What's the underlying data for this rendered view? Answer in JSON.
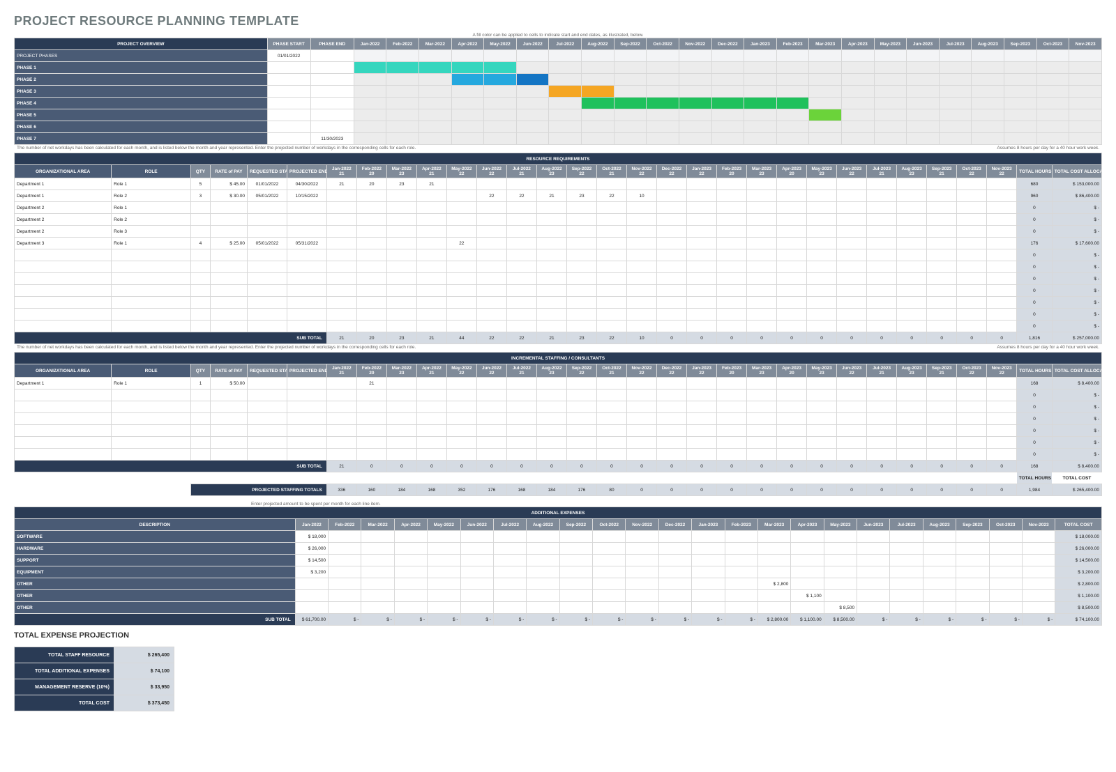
{
  "title": "PROJECT RESOURCE PLANNING TEMPLATE",
  "notes": {
    "gantt_hint": "A fill color can be applied to cells to indicate start and end dates, as illustrated, below.",
    "hours_hint": "The number of net workdays has been calculated for each month, and is listed below the month and year represented. Enter the projected number of workdays in the corresponding cells for each role.",
    "hours_assume": "Assumes 8 hours per day for a 40 hour work week.",
    "exp_hint": "Enter projected amount to be spent per month for each line item."
  },
  "months": [
    "Jan-2022",
    "Feb-2022",
    "Mar-2022",
    "Apr-2022",
    "May-2022",
    "Jun-2022",
    "Jul-2022",
    "Aug-2022",
    "Sep-2022",
    "Oct-2022",
    "Nov-2022",
    "Dec-2022",
    "Jan-2023",
    "Feb-2023",
    "Mar-2023",
    "Apr-2023",
    "May-2023",
    "Jun-2023",
    "Jul-2023",
    "Aug-2023",
    "Sep-2023",
    "Oct-2023",
    "Nov-2023"
  ],
  "workdays": [
    "21",
    "20",
    "23",
    "21",
    "22",
    "22",
    "21",
    "23",
    "22",
    "21",
    "22",
    "22",
    "22",
    "20",
    "23",
    "20",
    "23",
    "22",
    "21",
    "23",
    "21",
    "22",
    "22"
  ],
  "po": {
    "header": "PROJECT OVERVIEW",
    "cols": [
      "PHASE START",
      "PHASE END"
    ],
    "rows": [
      {
        "label": "PROJECT PHASES",
        "start": "01/01/2022",
        "end": "",
        "fill": []
      },
      {
        "label": "PHASE 1",
        "start": "",
        "end": "",
        "fill": [
          {
            "from": 0,
            "to": 4,
            "cls": "g1"
          }
        ]
      },
      {
        "label": "PHASE 2",
        "start": "",
        "end": "",
        "fill": [
          {
            "from": 3,
            "to": 4,
            "cls": "g2"
          },
          {
            "from": 5,
            "to": 5,
            "cls": "g2b"
          }
        ]
      },
      {
        "label": "PHASE 3",
        "start": "",
        "end": "",
        "fill": [
          {
            "from": 6,
            "to": 7,
            "cls": "g3"
          }
        ]
      },
      {
        "label": "PHASE 4",
        "start": "",
        "end": "",
        "fill": [
          {
            "from": 7,
            "to": 13,
            "cls": "g4"
          }
        ]
      },
      {
        "label": "PHASE 5",
        "start": "",
        "end": "",
        "fill": [
          {
            "from": 14,
            "to": 14,
            "cls": "g5"
          }
        ]
      },
      {
        "label": "PHASE 6",
        "start": "",
        "end": "",
        "fill": []
      },
      {
        "label": "PHASE 7",
        "start": "",
        "end": "11/30/2023",
        "fill": []
      }
    ]
  },
  "resource_header": "RESOURCE REQUIREMENTS",
  "resource_cols": {
    "area": "ORGANIZATIONAL AREA",
    "role": "ROLE",
    "qty": "QTY",
    "rate": "RATE of PAY",
    "start": "REQUESTED START DATE",
    "end": "PROJECTED END DATE",
    "thours": "TOTAL HOURS",
    "tcost": "TOTAL COST ALLOCATED"
  },
  "resource_rows": [
    {
      "area": "Department 1",
      "role": "Role 1",
      "qty": "5",
      "rate": "$   45.00",
      "start": "01/01/2022",
      "end": "04/30/2022",
      "wd": [
        "21",
        "20",
        "23",
        "21",
        "",
        "",
        "",
        "",
        "",
        "",
        "",
        "",
        "",
        "",
        "",
        "",
        "",
        "",
        "",
        "",
        "",
        "",
        ""
      ],
      "th": "680",
      "tc": "$   153,000.00"
    },
    {
      "area": "Department 1",
      "role": "Role 2",
      "qty": "3",
      "rate": "$   30.00",
      "start": "05/01/2022",
      "end": "10/15/2022",
      "wd": [
        "",
        "",
        "",
        "",
        "",
        "22",
        "22",
        "21",
        "23",
        "22",
        "10",
        "",
        "",
        "",
        "",
        "",
        "",
        "",
        "",
        "",
        "",
        "",
        ""
      ],
      "th": "960",
      "tc": "$    86,400.00"
    },
    {
      "area": "Department 2",
      "role": "Role 1",
      "qty": "",
      "rate": "",
      "start": "",
      "end": "",
      "wd": [
        "",
        "",
        "",
        "",
        "",
        "",
        "",
        "",
        "",
        "",
        "",
        "",
        "",
        "",
        "",
        "",
        "",
        "",
        "",
        "",
        "",
        "",
        ""
      ],
      "th": "0",
      "tc": "$          -"
    },
    {
      "area": "Department 2",
      "role": "Role 2",
      "qty": "",
      "rate": "",
      "start": "",
      "end": "",
      "wd": [
        "",
        "",
        "",
        "",
        "",
        "",
        "",
        "",
        "",
        "",
        "",
        "",
        "",
        "",
        "",
        "",
        "",
        "",
        "",
        "",
        "",
        "",
        ""
      ],
      "th": "0",
      "tc": "$          -"
    },
    {
      "area": "Department 2",
      "role": "Role 3",
      "qty": "",
      "rate": "",
      "start": "",
      "end": "",
      "wd": [
        "",
        "",
        "",
        "",
        "",
        "",
        "",
        "",
        "",
        "",
        "",
        "",
        "",
        "",
        "",
        "",
        "",
        "",
        "",
        "",
        "",
        "",
        ""
      ],
      "th": "0",
      "tc": "$          -"
    },
    {
      "area": "Department 3",
      "role": "Role 1",
      "qty": "4",
      "rate": "$   25.00",
      "start": "05/01/2022",
      "end": "05/31/2022",
      "wd": [
        "",
        "",
        "",
        "",
        "22",
        "",
        "",
        "",
        "",
        "",
        "",
        "",
        "",
        "",
        "",
        "",
        "",
        "",
        "",
        "",
        "",
        "",
        ""
      ],
      "th": "176",
      "tc": "$    17,600.00"
    },
    {
      "area": "",
      "role": "",
      "qty": "",
      "rate": "",
      "start": "",
      "end": "",
      "wd": [
        "",
        "",
        "",
        "",
        "",
        "",
        "",
        "",
        "",
        "",
        "",
        "",
        "",
        "",
        "",
        "",
        "",
        "",
        "",
        "",
        "",
        "",
        ""
      ],
      "th": "0",
      "tc": "$          -"
    },
    {
      "area": "",
      "role": "",
      "qty": "",
      "rate": "",
      "start": "",
      "end": "",
      "wd": [
        "",
        "",
        "",
        "",
        "",
        "",
        "",
        "",
        "",
        "",
        "",
        "",
        "",
        "",
        "",
        "",
        "",
        "",
        "",
        "",
        "",
        "",
        ""
      ],
      "th": "0",
      "tc": "$          -"
    },
    {
      "area": "",
      "role": "",
      "qty": "",
      "rate": "",
      "start": "",
      "end": "",
      "wd": [
        "",
        "",
        "",
        "",
        "",
        "",
        "",
        "",
        "",
        "",
        "",
        "",
        "",
        "",
        "",
        "",
        "",
        "",
        "",
        "",
        "",
        "",
        ""
      ],
      "th": "0",
      "tc": "$          -"
    },
    {
      "area": "",
      "role": "",
      "qty": "",
      "rate": "",
      "start": "",
      "end": "",
      "wd": [
        "",
        "",
        "",
        "",
        "",
        "",
        "",
        "",
        "",
        "",
        "",
        "",
        "",
        "",
        "",
        "",
        "",
        "",
        "",
        "",
        "",
        "",
        ""
      ],
      "th": "0",
      "tc": "$          -"
    },
    {
      "area": "",
      "role": "",
      "qty": "",
      "rate": "",
      "start": "",
      "end": "",
      "wd": [
        "",
        "",
        "",
        "",
        "",
        "",
        "",
        "",
        "",
        "",
        "",
        "",
        "",
        "",
        "",
        "",
        "",
        "",
        "",
        "",
        "",
        "",
        ""
      ],
      "th": "0",
      "tc": "$          -"
    },
    {
      "area": "",
      "role": "",
      "qty": "",
      "rate": "",
      "start": "",
      "end": "",
      "wd": [
        "",
        "",
        "",
        "",
        "",
        "",
        "",
        "",
        "",
        "",
        "",
        "",
        "",
        "",
        "",
        "",
        "",
        "",
        "",
        "",
        "",
        "",
        ""
      ],
      "th": "0",
      "tc": "$          -"
    },
    {
      "area": "",
      "role": "",
      "qty": "",
      "rate": "",
      "start": "",
      "end": "",
      "wd": [
        "",
        "",
        "",
        "",
        "",
        "",
        "",
        "",
        "",
        "",
        "",
        "",
        "",
        "",
        "",
        "",
        "",
        "",
        "",
        "",
        "",
        "",
        ""
      ],
      "th": "0",
      "tc": "$          -"
    }
  ],
  "resource_subtotal": {
    "label": "SUB TOTAL",
    "wd": [
      "21",
      "20",
      "23",
      "21",
      "44",
      "22",
      "22",
      "21",
      "23",
      "22",
      "10",
      "0",
      "0",
      "0",
      "0",
      "0",
      "0",
      "0",
      "0",
      "0",
      "0",
      "0",
      "0"
    ],
    "th": "1,816",
    "tc": "$   257,000.00"
  },
  "inc_header": "INCREMENTAL STAFFING / CONSULTANTS",
  "inc_rows": [
    {
      "area": "Department 1",
      "role": "Role 1",
      "qty": "1",
      "rate": "$   50.00",
      "start": "",
      "end": "",
      "wd": [
        "",
        "21",
        "",
        "",
        "",
        "",
        "",
        "",
        "",
        "",
        "",
        "",
        "",
        "",
        "",
        "",
        "",
        "",
        "",
        "",
        "",
        "",
        ""
      ],
      "th": "168",
      "tc": "$     8,400.00"
    },
    {
      "area": "",
      "role": "",
      "qty": "",
      "rate": "",
      "start": "",
      "end": "",
      "wd": [
        "",
        "",
        "",
        "",
        "",
        "",
        "",
        "",
        "",
        "",
        "",
        "",
        "",
        "",
        "",
        "",
        "",
        "",
        "",
        "",
        "",
        "",
        ""
      ],
      "th": "0",
      "tc": "$          -"
    },
    {
      "area": "",
      "role": "",
      "qty": "",
      "rate": "",
      "start": "",
      "end": "",
      "wd": [
        "",
        "",
        "",
        "",
        "",
        "",
        "",
        "",
        "",
        "",
        "",
        "",
        "",
        "",
        "",
        "",
        "",
        "",
        "",
        "",
        "",
        "",
        ""
      ],
      "th": "0",
      "tc": "$          -"
    },
    {
      "area": "",
      "role": "",
      "qty": "",
      "rate": "",
      "start": "",
      "end": "",
      "wd": [
        "",
        "",
        "",
        "",
        "",
        "",
        "",
        "",
        "",
        "",
        "",
        "",
        "",
        "",
        "",
        "",
        "",
        "",
        "",
        "",
        "",
        "",
        ""
      ],
      "th": "0",
      "tc": "$          -"
    },
    {
      "area": "",
      "role": "",
      "qty": "",
      "rate": "",
      "start": "",
      "end": "",
      "wd": [
        "",
        "",
        "",
        "",
        "",
        "",
        "",
        "",
        "",
        "",
        "",
        "",
        "",
        "",
        "",
        "",
        "",
        "",
        "",
        "",
        "",
        "",
        ""
      ],
      "th": "0",
      "tc": "$          -"
    },
    {
      "area": "",
      "role": "",
      "qty": "",
      "rate": "",
      "start": "",
      "end": "",
      "wd": [
        "",
        "",
        "",
        "",
        "",
        "",
        "",
        "",
        "",
        "",
        "",
        "",
        "",
        "",
        "",
        "",
        "",
        "",
        "",
        "",
        "",
        "",
        ""
      ],
      "th": "0",
      "tc": "$          -"
    },
    {
      "area": "",
      "role": "",
      "qty": "",
      "rate": "",
      "start": "",
      "end": "",
      "wd": [
        "",
        "",
        "",
        "",
        "",
        "",
        "",
        "",
        "",
        "",
        "",
        "",
        "",
        "",
        "",
        "",
        "",
        "",
        "",
        "",
        "",
        "",
        ""
      ],
      "th": "0",
      "tc": "$          -"
    }
  ],
  "inc_subtotal": {
    "label": "SUB TOTAL",
    "wd": [
      "21",
      "0",
      "0",
      "0",
      "0",
      "0",
      "0",
      "0",
      "0",
      "0",
      "0",
      "0",
      "0",
      "0",
      "0",
      "0",
      "0",
      "0",
      "0",
      "0",
      "0",
      "0",
      "0"
    ],
    "th": "168",
    "tc": "$     8,400.00"
  },
  "inc_totals_label": {
    "th": "TOTAL HOURS",
    "tc": "TOTAL COST"
  },
  "proj_total": {
    "label": "PROJECTED STAFFING TOTALS",
    "wd": [
      "336",
      "160",
      "184",
      "168",
      "352",
      "176",
      "168",
      "184",
      "176",
      "80",
      "0",
      "0",
      "0",
      "0",
      "0",
      "0",
      "0",
      "0",
      "0",
      "0",
      "0",
      "0",
      "0"
    ],
    "th": "1,984",
    "tc": "$   265,400.00"
  },
  "exp_header": "ADDITIONAL EXPENSES",
  "exp_cols": {
    "desc": "DESCRIPTION",
    "tot": "TOTAL COST"
  },
  "exp_rows": [
    {
      "desc": "SOFTWARE",
      "m": [
        "$   18,000",
        "",
        "",
        "",
        "",
        "",
        "",
        "",
        "",
        "",
        "",
        "",
        "",
        "",
        "",
        "",
        "",
        "",
        "",
        "",
        "",
        "",
        ""
      ],
      "tot": "$   18,000.00"
    },
    {
      "desc": "HARDWARE",
      "m": [
        "$   26,000",
        "",
        "",
        "",
        "",
        "",
        "",
        "",
        "",
        "",
        "",
        "",
        "",
        "",
        "",
        "",
        "",
        "",
        "",
        "",
        "",
        "",
        ""
      ],
      "tot": "$   26,000.00"
    },
    {
      "desc": "SUPPORT",
      "m": [
        "$   14,500",
        "",
        "",
        "",
        "",
        "",
        "",
        "",
        "",
        "",
        "",
        "",
        "",
        "",
        "",
        "",
        "",
        "",
        "",
        "",
        "",
        "",
        ""
      ],
      "tot": "$   14,500.00"
    },
    {
      "desc": "EQUIPMENT",
      "m": [
        "$    3,200",
        "",
        "",
        "",
        "",
        "",
        "",
        "",
        "",
        "",
        "",
        "",
        "",
        "",
        "",
        "",
        "",
        "",
        "",
        "",
        "",
        "",
        ""
      ],
      "tot": "$    3,200.00"
    },
    {
      "desc": "OTHER",
      "m": [
        "",
        "",
        "",
        "",
        "",
        "",
        "",
        "",
        "",
        "",
        "",
        "",
        "",
        "",
        "$   2,800",
        "",
        "",
        "",
        "",
        "",
        "",
        "",
        ""
      ],
      "tot": "$    2,800.00"
    },
    {
      "desc": "OTHER",
      "m": [
        "",
        "",
        "",
        "",
        "",
        "",
        "",
        "",
        "",
        "",
        "",
        "",
        "",
        "",
        "",
        "$   1,100",
        "",
        "",
        "",
        "",
        "",
        "",
        ""
      ],
      "tot": "$    1,100.00"
    },
    {
      "desc": "OTHER",
      "m": [
        "",
        "",
        "",
        "",
        "",
        "",
        "",
        "",
        "",
        "",
        "",
        "",
        "",
        "",
        "",
        "",
        "$   8,500",
        "",
        "",
        "",
        "",
        "",
        ""
      ],
      "tot": "$    8,500.00"
    }
  ],
  "exp_subtotal": {
    "label": "SUB TOTAL",
    "m": [
      "$ 61,700.00",
      "$      -",
      "$      -",
      "$      -",
      "$      -",
      "$      -",
      "$      -",
      "$      -",
      "$      -",
      "$      -",
      "$      -",
      "$      -",
      "$      -",
      "$      -",
      "$ 2,800.00",
      "$ 1,100.00",
      "$ 8,500.00",
      "$      -",
      "$      -",
      "$      -",
      "$      -",
      "$      -",
      "$      -"
    ],
    "tot": "$   74,100.00"
  },
  "totals_header": "TOTAL EXPENSE PROJECTION",
  "totals": [
    {
      "label": "TOTAL STAFF RESOURCE",
      "val": "$            265,400"
    },
    {
      "label": "TOTAL ADDITIONAL EXPENSES",
      "val": "$             74,100"
    },
    {
      "label": "MANAGEMENT RESERVE (10%)",
      "val": "$             33,950"
    },
    {
      "label": "TOTAL COST",
      "val": "$            373,450"
    }
  ]
}
